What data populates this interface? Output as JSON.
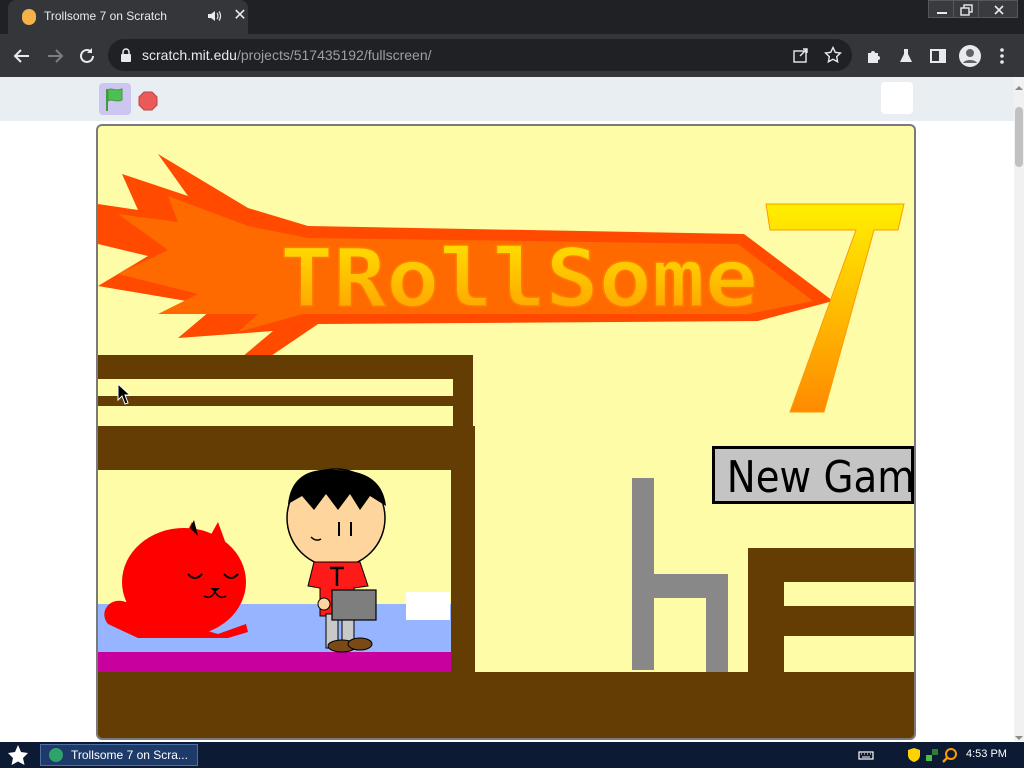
{
  "browser": {
    "tab": {
      "title": "Trollsome 7 on Scratch",
      "favicon": "scratch-cat-icon",
      "audio_icon": "speaker-icon",
      "close_icon": "close-icon"
    },
    "window_controls": [
      "minimize-icon",
      "restore-icon",
      "close-icon"
    ],
    "nav": {
      "back_icon": "back-arrow-icon",
      "forward_icon": "forward-arrow-icon",
      "reload_icon": "reload-icon"
    },
    "address": {
      "host": "scratch.mit.edu",
      "path": "/projects/517435192/fullscreen/"
    },
    "toolbar_icons": [
      "share-icon",
      "bookmark-star-icon",
      "extensions-icon",
      "labs-flask-icon",
      "side-panel-icon",
      "profile-icon",
      "menu-kebab-icon"
    ]
  },
  "scratch": {
    "controls": {
      "green_flag": "green-flag-icon",
      "stop": "stop-icon",
      "fullscreen": "fullscreen-toggle"
    },
    "stage": {
      "logo_text": "TRollSome",
      "logo_number": "7",
      "new_game_label": "New Game",
      "colors": {
        "background": "#fffca7",
        "wood": "#643d04",
        "logo_flame": "#ff4a00",
        "logo_text": "#ffc000",
        "cat": "#ff0000",
        "blanket": "#96b4ff",
        "bed_base": "#c8009e",
        "chair": "#888888"
      }
    }
  },
  "taskbar": {
    "start_icon": "start-star-icon",
    "window_button": "Trollsome 7 on Scra...",
    "tray_icons": [
      "keyboard-icon",
      "shield-icon",
      "network-icon",
      "search-icon"
    ],
    "clock": "4:53 PM"
  }
}
